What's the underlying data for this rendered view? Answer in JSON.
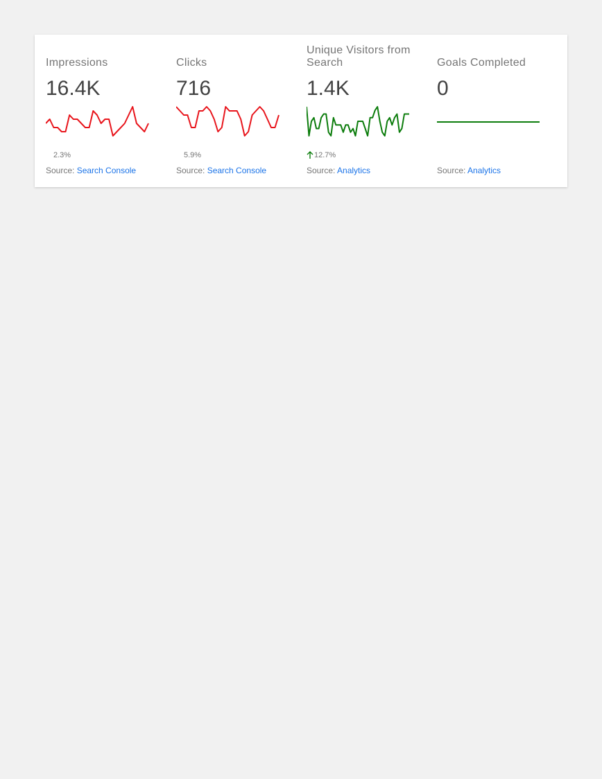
{
  "colors": {
    "negative": "#e8141b",
    "positive": "#0b7c0b",
    "link": "#1a73e8"
  },
  "metrics": [
    {
      "title": "Impressions",
      "value": "16.4K",
      "change": "2.3%",
      "direction": "down",
      "trend_color": "#e8141b",
      "source_prefix": "Source:",
      "source_link": "Search Console",
      "series": [
        3,
        4,
        2,
        2,
        1,
        1,
        5,
        4,
        4,
        3,
        2,
        2,
        6,
        5,
        3,
        4,
        4,
        0,
        1,
        2,
        3,
        5,
        7,
        3,
        2,
        1,
        3
      ]
    },
    {
      "title": "Clicks",
      "value": "716",
      "change": "5.9%",
      "direction": "down",
      "trend_color": "#e8141b",
      "source_prefix": "Source:",
      "source_link": "Search Console",
      "series": [
        8,
        7,
        6,
        6,
        3,
        3,
        7,
        7,
        8,
        7,
        5,
        2,
        3,
        8,
        7,
        7,
        7,
        5,
        1,
        2,
        6,
        7,
        8,
        7,
        5,
        3,
        3,
        6
      ]
    },
    {
      "title": "Unique Visitors from Search",
      "value": "1.4K",
      "change": "12.7%",
      "direction": "up",
      "trend_color": "#0b7c0b",
      "source_prefix": "Source:",
      "source_link": "Analytics",
      "series": [
        10,
        2,
        6,
        7,
        4,
        4,
        7,
        8,
        8,
        3,
        2,
        7,
        5,
        5,
        5,
        3,
        5,
        5,
        3,
        4,
        2,
        6,
        6,
        6,
        4,
        2,
        7,
        7,
        9,
        10,
        6,
        3,
        2,
        6,
        7,
        5,
        7,
        8,
        3,
        4,
        8,
        8,
        8
      ]
    },
    {
      "title": "Goals Completed",
      "value": "0",
      "change": "",
      "direction": "flat",
      "trend_color": "#0b7c0b",
      "source_prefix": "Source:",
      "source_link": "Analytics",
      "series": [
        0,
        0,
        0,
        0,
        0,
        0,
        0,
        0,
        0,
        0
      ]
    }
  ]
}
